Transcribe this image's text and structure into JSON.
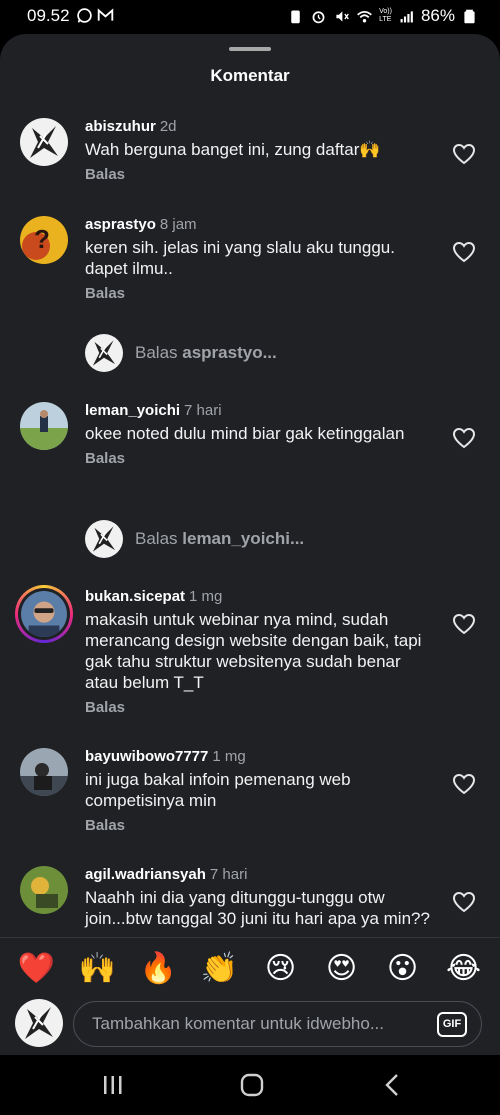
{
  "status_bar": {
    "time": "09.52",
    "battery": "86%",
    "network_label_1": "Vo))",
    "network_label_2": "LTE"
  },
  "sheet": {
    "title": "Komentar"
  },
  "reply_label": "Balas",
  "comments": [
    {
      "username": "abiszuhur",
      "time": "2d",
      "text": "Wah berguna banget ini, zung daftar🙌"
    },
    {
      "username": "asprastyo",
      "time": "8 jam",
      "text": "keren sih. jelas ini yang slalu aku tunggu. dapet ilmu.."
    },
    {
      "username": "leman_yoichi",
      "time": "7 hari",
      "text": "okee noted dulu mind biar gak ketinggalan"
    },
    {
      "username": "bukan.sicepat",
      "time": "1 mg",
      "text": "makasih untuk webinar nya mind, sudah merancang design website dengan baik, tapi gak tahu struktur websitenya sudah benar atau belum T_T"
    },
    {
      "username": "bayuwibowo7777",
      "time": "1 mg",
      "text": "ini juga bakal infoin pemenang web competisinya min"
    },
    {
      "username": "agil.wadriansyah",
      "time": "7 hari",
      "text": "Naahh ini dia yang ditunggu-tunggu otw join...btw tanggal 30 juni itu hari apa ya min??"
    }
  ],
  "reply_rows": [
    {
      "prefix": "Balas",
      "user": "asprastyo..."
    },
    {
      "prefix": "Balas",
      "user": "leman_yoichi..."
    }
  ],
  "emojis": [
    "❤️",
    "🙌",
    "🔥",
    "👏",
    "😢",
    "😍",
    "😮",
    "😂"
  ],
  "input": {
    "placeholder": "Tambahkan komentar untuk idwebho...",
    "gif_label": "GIF"
  },
  "icons": {
    "heart": "heart-outline-icon",
    "nav_recent": "recent-apps-icon",
    "nav_home": "home-icon",
    "nav_back": "back-icon"
  }
}
